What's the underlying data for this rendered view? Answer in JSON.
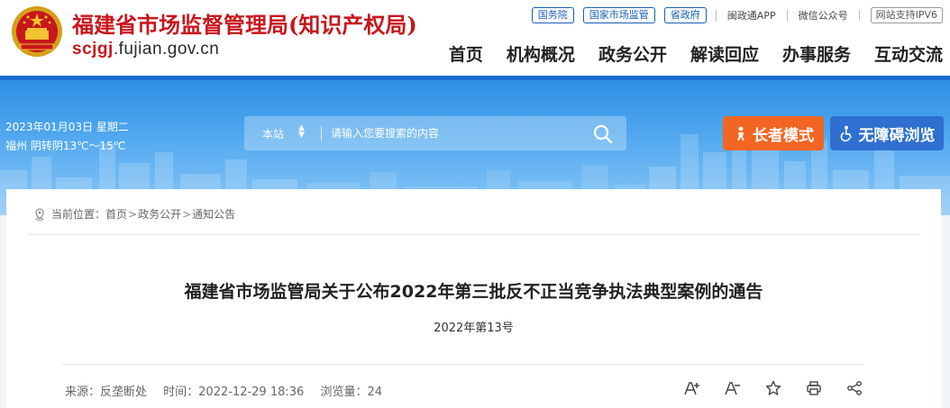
{
  "header": {
    "site_title": "福建省市场监督管理局(知识产权局)",
    "domain_prefix": "scjgj",
    "domain_rest": ".fujian.gov.cn",
    "top_links": [
      "国务院",
      "国家市场监管",
      "省政府"
    ],
    "app_link": "闽政通APP",
    "wechat_link": "微信公众号",
    "ipv6_badge": "网站支持IPV6",
    "nav": [
      "首页",
      "机构概况",
      "政务公开",
      "解读回应",
      "办事服务",
      "互动交流"
    ]
  },
  "banner": {
    "date_line": "2023年01月03日 星期二",
    "weather_line": "福州 阴转阴13℃～15℃",
    "search_scope": "本站",
    "search_placeholder": "请输入您要搜索的内容",
    "elder_mode": "长者模式",
    "accessibility": "无障碍浏览"
  },
  "breadcrumb": {
    "prefix": "当前位置：",
    "items": [
      "首页",
      "政务公开",
      "通知公告"
    ]
  },
  "article": {
    "title": "福建省市场监管局关于公布2022年第三批反不正当竞争执法典型案例的通告",
    "doc_number": "2022年第13号",
    "source": "来源：反垄断处",
    "time": "时间：2022-12-29 18:36",
    "views": "浏览量：24"
  },
  "colors": {
    "brand_red": "#c8161d",
    "nav_blue": "#1a6fd0",
    "elder_orange": "#f26522",
    "access_blue": "#2e6fd0"
  },
  "icons": [
    "emblem",
    "search-icon",
    "elder-icon",
    "wheelchair-icon",
    "location-icon",
    "font-increase-icon",
    "font-decrease-icon",
    "star-icon",
    "print-icon",
    "share-icon"
  ]
}
